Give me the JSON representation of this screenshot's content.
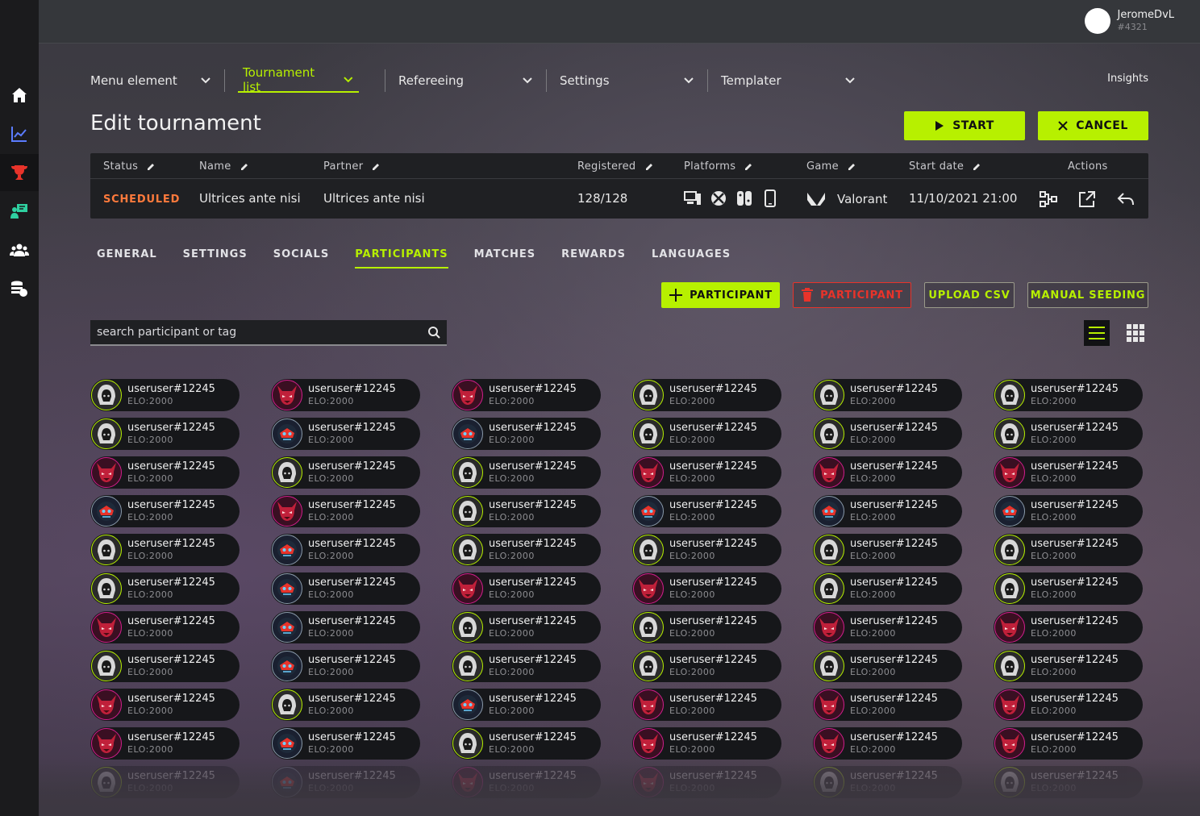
{
  "user": {
    "name": "JeromeDvL",
    "tag": "#4321"
  },
  "sidebar": {
    "items": [
      {
        "name": "home-icon",
        "active": false
      },
      {
        "name": "chart-icon",
        "active": false
      },
      {
        "name": "trophy-icon",
        "active": true
      },
      {
        "name": "scoreboard-icon",
        "active": false
      },
      {
        "name": "users-icon",
        "active": false
      },
      {
        "name": "coins-icon",
        "active": false
      }
    ]
  },
  "menu": {
    "items": [
      {
        "label": "Menu element",
        "active": false
      },
      {
        "label": "Tournament list",
        "active": true
      },
      {
        "label": "Refereeing",
        "active": false
      },
      {
        "label": "Settings",
        "active": false
      },
      {
        "label": "Templater",
        "active": false
      }
    ],
    "insights": "Insights"
  },
  "page": {
    "title": "Edit tournament",
    "start_label": "START",
    "cancel_label": "CANCEL"
  },
  "tournament": {
    "headers": {
      "status": "Status",
      "name": "Name",
      "partner": "Partner",
      "registered": "Registered",
      "platforms": "Platforms",
      "game": "Game",
      "start_date": "Start date",
      "actions": "Actions"
    },
    "row": {
      "status": "SCHEDULED",
      "name": "Ultrices ante nisi",
      "partner": "Ultrices ante nisi",
      "registered": "128/128",
      "platforms": [
        "pc-icon",
        "xbox-icon",
        "switch-icon",
        "mobile-icon"
      ],
      "game": "Valorant",
      "start_date": "11/10/2021 21:00"
    }
  },
  "tabs": [
    {
      "label": "GENERAL",
      "active": false
    },
    {
      "label": "SETTINGS",
      "active": false
    },
    {
      "label": "SOCIALS",
      "active": false
    },
    {
      "label": "PARTICIPANTS",
      "active": true
    },
    {
      "label": "MATCHES",
      "active": false
    },
    {
      "label": "REWARDS",
      "active": false
    },
    {
      "label": "LANGUAGES",
      "active": false
    }
  ],
  "participants_toolbar": {
    "add_label": "PARTICIPANT",
    "delete_label": "PARTICIPANT",
    "upload_label": "UPLOAD CSV",
    "seeding_label": "MANUAL SEEDING"
  },
  "search": {
    "placeholder": "search participant or tag",
    "value": ""
  },
  "view": {
    "active": "list"
  },
  "participant_name": "useruser#12245",
  "participant_elo": "ELO:2000",
  "participant_avatars": [
    [
      "hood",
      "demon",
      "demon",
      "hood",
      "hood",
      "hood"
    ],
    [
      "hood",
      "robot",
      "robot",
      "hood",
      "hood",
      "hood"
    ],
    [
      "demon",
      "hood",
      "hood",
      "demon",
      "demon",
      "demon"
    ],
    [
      "robot",
      "demon",
      "hood",
      "robot",
      "robot",
      "robot"
    ],
    [
      "hood",
      "robot",
      "hood",
      "hood",
      "hood",
      "hood"
    ],
    [
      "hood",
      "robot",
      "demon",
      "demon",
      "hood",
      "hood"
    ],
    [
      "demon",
      "robot",
      "hood",
      "hood",
      "demon",
      "demon"
    ],
    [
      "hood",
      "robot",
      "hood",
      "hood",
      "hood",
      "hood"
    ],
    [
      "demon",
      "hood",
      "robot",
      "demon",
      "demon",
      "demon"
    ],
    [
      "demon",
      "robot",
      "hood",
      "demon",
      "demon",
      "demon"
    ],
    [
      "hood",
      "robot",
      "demon",
      "demon",
      "hood",
      "hood"
    ]
  ],
  "colors": {
    "accent": "#b7f000",
    "danger": "#e8332a",
    "status_scheduled": "#ff7a3c",
    "demon_ring": "#d21e8c",
    "hood_ring": "#b7f000"
  }
}
